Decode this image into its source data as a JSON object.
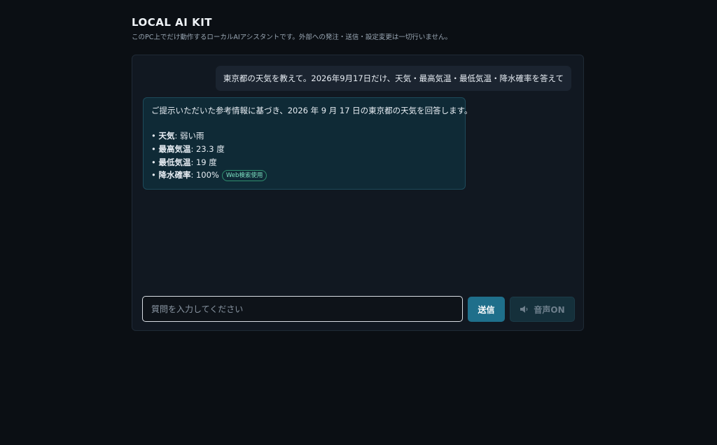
{
  "header": {
    "title": "LOCAL AI KIT",
    "subtitle": "このPC上でだけ動作するローカルAIアシスタントです。外部への発注・送信・設定変更は一切行いません。"
  },
  "chat": {
    "user_message": "東京都の天気を教えて。2026年9月17日だけ、天気・最高気温・最低気温・降水確率を答えて",
    "assistant": {
      "intro": "ご提示いただいた参考情報に基づき、2026 年 9 月 17 日の東京都の天気を回答します。",
      "items": [
        {
          "key": "天気",
          "value": ": 弱い雨"
        },
        {
          "key": "最高気温",
          "value": ": 23.3 度"
        },
        {
          "key": "最低気温",
          "value": ": 19 度"
        },
        {
          "key": "降水確率",
          "value": ": 100%"
        }
      ],
      "bullet": "•",
      "badge": "Web検索使用"
    }
  },
  "input": {
    "placeholder": "質問を入力してください",
    "value": ""
  },
  "buttons": {
    "send_label": "送信",
    "voice_label": "音声ON",
    "voice_icon": "speaker-icon"
  },
  "colors": {
    "background": "#0b0f14",
    "panel": "#111821",
    "accent": "#1f6f8b",
    "badge": "#7ee0c2"
  }
}
